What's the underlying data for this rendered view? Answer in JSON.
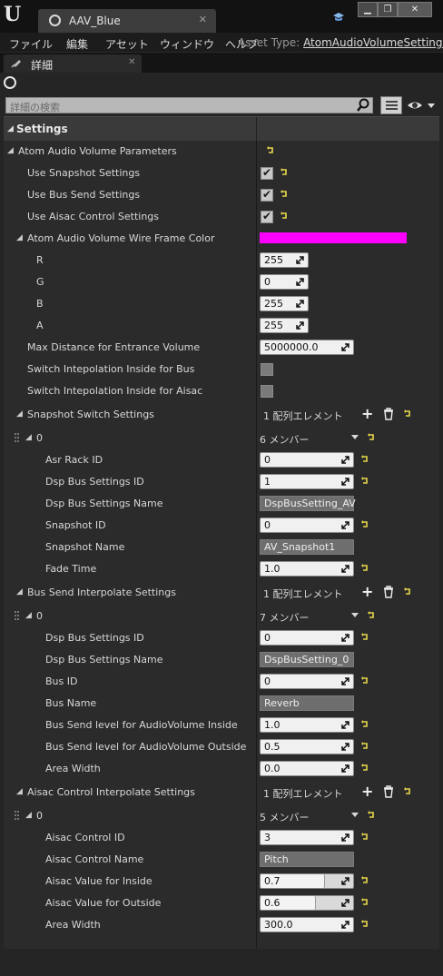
{
  "window": {
    "tab_label": "AAV_Blue",
    "tab_close": "✕",
    "min_glyph": "▁",
    "max_glyph": "❐",
    "close_glyph": "✕"
  },
  "menu": {
    "items": [
      "ファイル",
      "編集",
      "アセット",
      "ウィンドウ",
      "ヘルプ"
    ],
    "asset_type_label": "Asset Type:",
    "asset_type_value": "AtomAudioVolumeSettings"
  },
  "panel": {
    "tab_label": "詳細",
    "tab_close": "✕",
    "search_placeholder": "詳細の検索",
    "category": "Settings"
  },
  "params": {
    "group_label": "Atom Audio Volume Parameters",
    "use_snapshot": {
      "label": "Use Snapshot Settings",
      "checked": true
    },
    "use_bus_send": {
      "label": "Use Bus Send Settings",
      "checked": true
    },
    "use_aisac": {
      "label": "Use Aisac Control Settings",
      "checked": true
    },
    "wire_color": {
      "label": "Atom Audio Volume Wire Frame Color",
      "color": "#ff00ff"
    },
    "r": {
      "label": "R",
      "value": "255"
    },
    "g": {
      "label": "G",
      "value": "0"
    },
    "b": {
      "label": "B",
      "value": "255"
    },
    "a": {
      "label": "A",
      "value": "255"
    },
    "max_distance": {
      "label": "Max Distance for Entrance Volume",
      "value": "5000000.0"
    },
    "switch_bus": {
      "label": "Switch Intepolation Inside for Bus",
      "checked": false
    },
    "switch_aisac": {
      "label": "Switch Intepolation Inside for Aisac",
      "checked": false
    }
  },
  "snapshot": {
    "label": "Snapshot Switch Settings",
    "array_text": "1 配列エレメント",
    "index": "0",
    "members": "6 メンバー",
    "asr_rack_id": {
      "label": "Asr Rack ID",
      "value": "0"
    },
    "dsp_bus_settings_id": {
      "label": "Dsp Bus Settings ID",
      "value": "1"
    },
    "dsp_bus_settings_name": {
      "label": "Dsp Bus Settings Name",
      "value": "DspBusSetting_AV"
    },
    "snapshot_id": {
      "label": "Snapshot ID",
      "value": "0"
    },
    "snapshot_name": {
      "label": "Snapshot Name",
      "value": "AV_Snapshot1"
    },
    "fade_time": {
      "label": "Fade Time",
      "value": "1.0"
    }
  },
  "bus_send": {
    "label": "Bus Send Interpolate Settings",
    "array_text": "1 配列エレメント",
    "index": "0",
    "members": "7 メンバー",
    "dsp_bus_settings_id": {
      "label": "Dsp Bus Settings ID",
      "value": "0"
    },
    "dsp_bus_settings_name": {
      "label": "Dsp Bus Settings Name",
      "value": "DspBusSetting_0"
    },
    "bus_id": {
      "label": "Bus ID",
      "value": "0"
    },
    "bus_name": {
      "label": "Bus Name",
      "value": "Reverb"
    },
    "level_inside": {
      "label": "Bus Send level for AudioVolume Inside",
      "value": "1.0"
    },
    "level_outside": {
      "label": "Bus Send level for AudioVolume Outside",
      "value": "0.5"
    },
    "area_width": {
      "label": "Area Width",
      "value": "0.0"
    }
  },
  "aisac": {
    "label": "Aisac Control Interpolate Settings",
    "array_text": "1 配列エレメント",
    "index": "0",
    "members": "5 メンバー",
    "control_id": {
      "label": "Aisac Control ID",
      "value": "3"
    },
    "control_name": {
      "label": "Aisac Control Name",
      "value": "Pitch"
    },
    "value_inside": {
      "label": "Aisac Value for Inside",
      "value": "0.7",
      "fill": 0.7
    },
    "value_outside": {
      "label": "Aisac Value for Outside",
      "value": "0.6",
      "fill": 0.6
    },
    "area_width": {
      "label": "Area Width",
      "value": "300.0"
    }
  },
  "colors": {
    "accent_reset": "#e8d84a",
    "panel_bg": "#2b2b2b"
  },
  "icons": {
    "check": "✔",
    "collapse_triangle": "◢",
    "plus": "+"
  }
}
